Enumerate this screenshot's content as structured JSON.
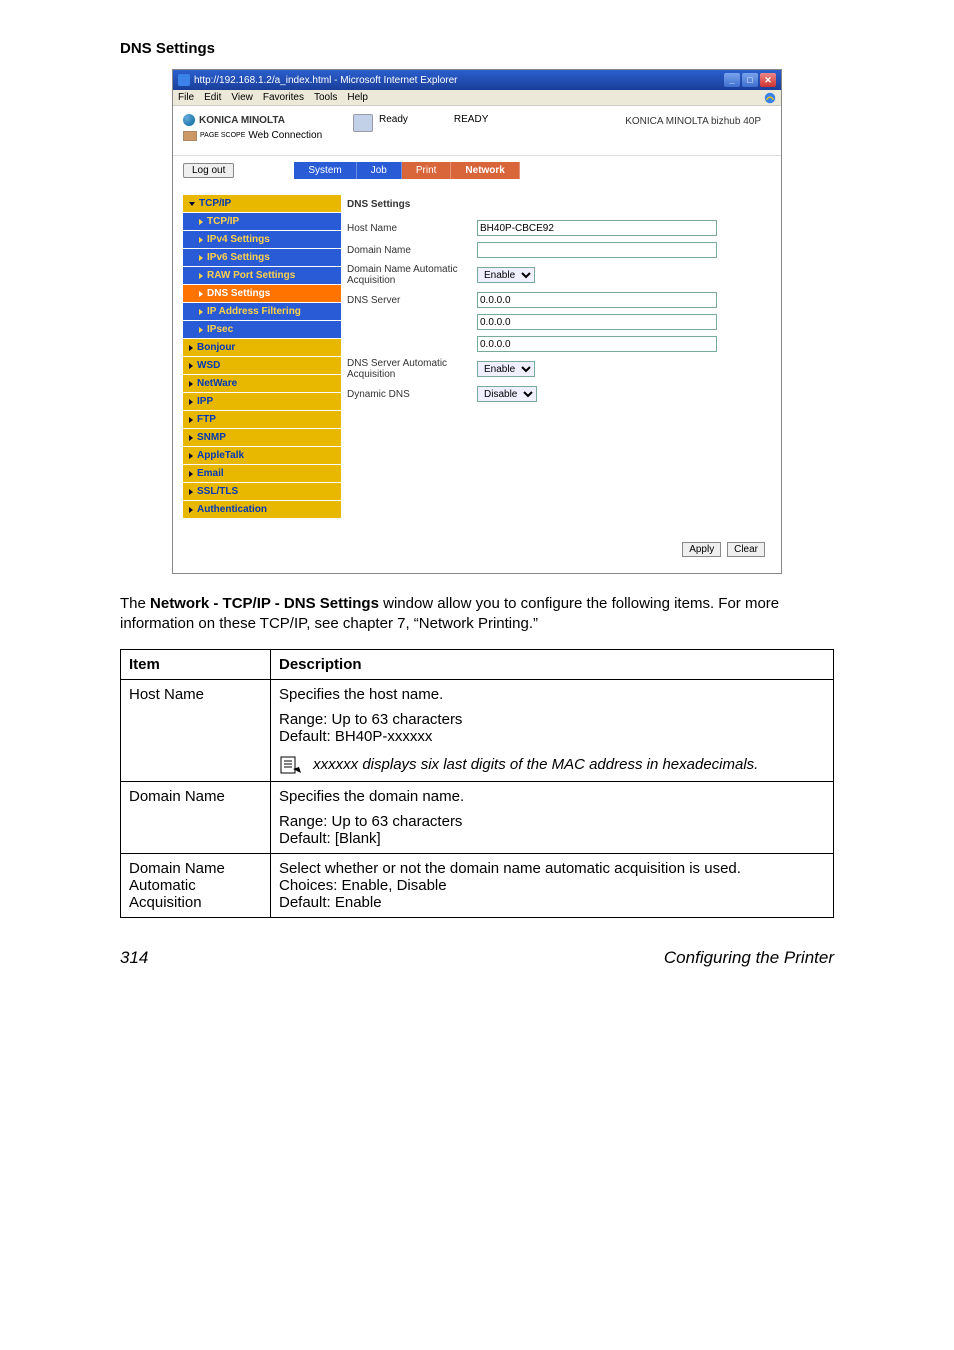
{
  "heading": "DNS Settings",
  "window": {
    "title": "http://192.168.1.2/a_index.html - Microsoft Internet Explorer",
    "menus": [
      "File",
      "Edit",
      "View",
      "Favorites",
      "Tools",
      "Help"
    ]
  },
  "brand": {
    "name": "KONICA MINOLTA",
    "sub": "Web Connection",
    "sub_prefix": "PAGE SCOPE"
  },
  "status": {
    "icon_label": "Ready",
    "ready": "READY"
  },
  "device": "KONICA MINOLTA bizhub 40P",
  "logout": "Log out",
  "tabs": {
    "system": "System",
    "job": "Job",
    "print": "Print",
    "network": "Network"
  },
  "sidebar": {
    "group": "TCP/IP",
    "items": [
      "TCP/IP",
      "IPv4 Settings",
      "IPv6 Settings",
      "RAW Port Settings",
      "DNS Settings",
      "IP Address Filtering",
      "IPsec"
    ],
    "groups2": [
      "Bonjour",
      "WSD",
      "NetWare",
      "IPP",
      "FTP",
      "SNMP",
      "AppleTalk",
      "Email",
      "SSL/TLS",
      "Authentication"
    ]
  },
  "content": {
    "title": "DNS Settings",
    "rows": {
      "host_name": {
        "label": "Host Name",
        "value": "BH40P-CBCE92"
      },
      "domain_name": {
        "label": "Domain Name",
        "value": ""
      },
      "domain_auto": {
        "label": "Domain Name Automatic Acquisition",
        "value": "Enable"
      },
      "dns_server": {
        "label": "DNS Server",
        "v1": "0.0.0.0",
        "v2": "0.0.0.0",
        "v3": "0.0.0.0"
      },
      "dns_auto": {
        "label": "DNS Server Automatic Acquisition",
        "value": "Enable"
      },
      "dynamic": {
        "label": "Dynamic DNS",
        "value": "Disable"
      }
    },
    "apply": "Apply",
    "clear": "Clear"
  },
  "body_text": {
    "p1a": "The ",
    "p1b": "Network - TCP/IP - DNS Settings",
    "p1c": " window allow you to configure the following items. For more information on these TCP/IP, see chapter 7,  “Network Printing.”"
  },
  "table": {
    "h_item": "Item",
    "h_desc": "Description",
    "rows": [
      {
        "item": "Host Name",
        "desc_lines": [
          "Specifies the host name.",
          "Range:   Up to 63 characters",
          "Default:  BH40P-xxxxxx"
        ],
        "note": "xxxxxx displays six last digits of the MAC address in hexadecimals."
      },
      {
        "item": "Domain Name",
        "desc_lines": [
          "Specifies the domain name.",
          "Range:   Up to 63 characters",
          "Default:  [Blank]"
        ]
      },
      {
        "item": "Domain Name Automatic Acquisition",
        "desc_lines": [
          "Select whether or not the domain name automatic acquisition is used.",
          "Choices: Enable, Disable",
          "Default:  Enable"
        ]
      }
    ]
  },
  "footer": {
    "page": "314",
    "title": "Configuring the Printer"
  }
}
